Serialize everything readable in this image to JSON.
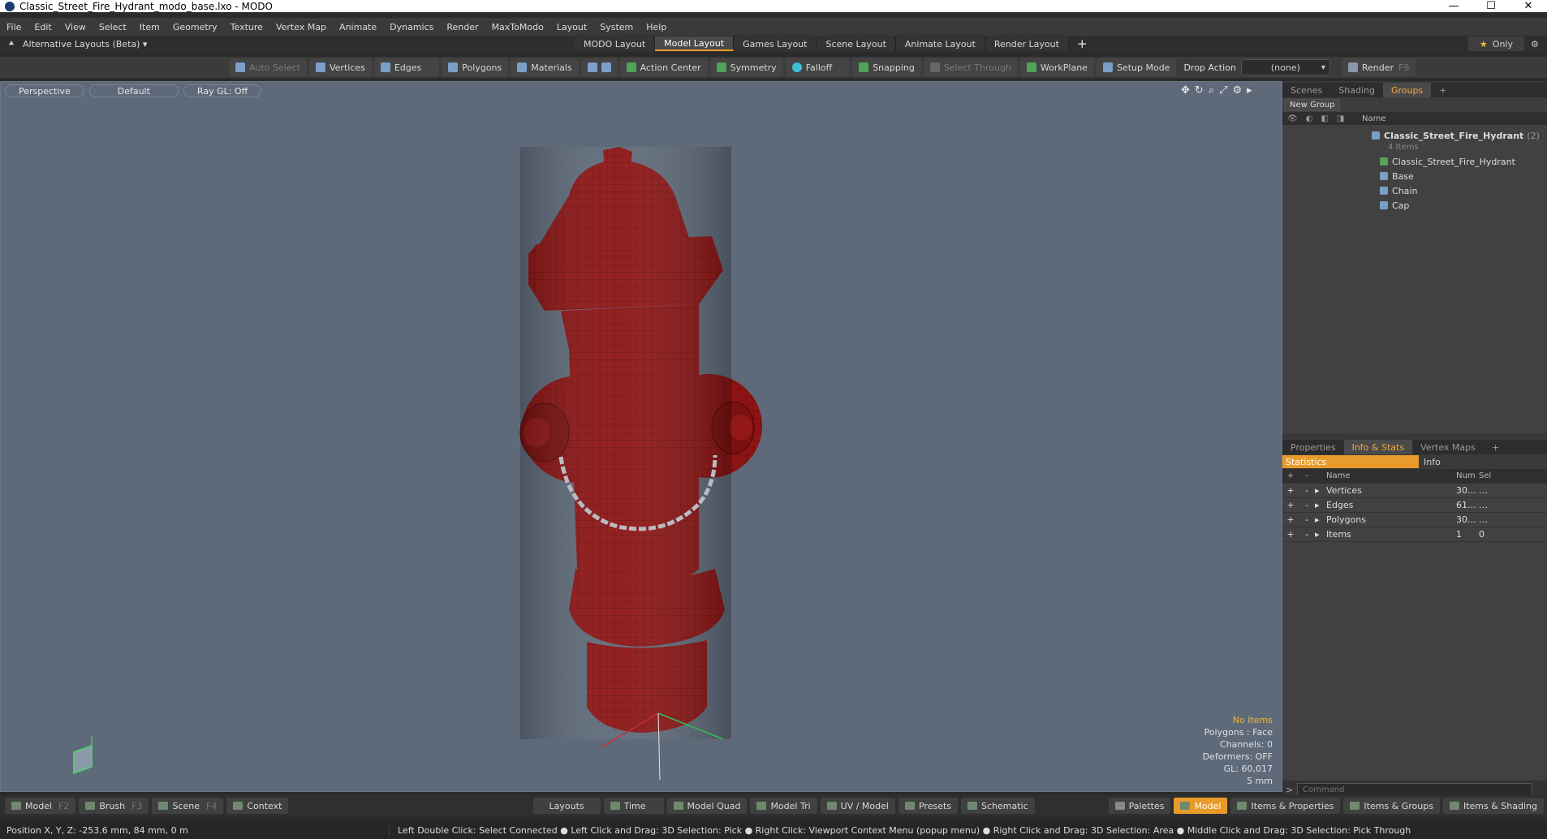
{
  "window": {
    "title": "Classic_Street_Fire_Hydrant_modo_base.lxo - MODO",
    "min": "—",
    "max": "☐",
    "close": "✕"
  },
  "menu": [
    "File",
    "Edit",
    "View",
    "Select",
    "Item",
    "Geometry",
    "Texture",
    "Vertex Map",
    "Animate",
    "Dynamics",
    "Render",
    "MaxToModo",
    "Layout",
    "System",
    "Help"
  ],
  "layoutbar": {
    "alt_layouts": "Alternative Layouts (Beta)",
    "tabs": [
      "MODO Layout",
      "Model Layout",
      "Games Layout",
      "Scene Layout",
      "Animate Layout",
      "Render Layout"
    ],
    "active_tab": "Model Layout",
    "add": "+",
    "only": "Only"
  },
  "toolbar": {
    "auto_select": "Auto Select",
    "vertices": "Vertices",
    "edges": "Edges",
    "polygons": "Polygons",
    "materials": "Materials",
    "action_center": "Action Center",
    "symmetry": "Symmetry",
    "falloff": "Falloff",
    "snapping": "Snapping",
    "select_through": "Select Through",
    "workplane": "WorkPlane",
    "setup_mode": "Setup Mode",
    "drop_action": "Drop Action",
    "drop_value": "(none)",
    "render": "Render",
    "render_key": "F9"
  },
  "viewport": {
    "perspective": "Perspective",
    "default": "Default",
    "raygl": "Ray GL: Off",
    "info": {
      "no_items": "No Items",
      "polygons": "Polygons : Face",
      "channels": "Channels: 0",
      "deformers": "Deformers: OFF",
      "gl": "GL: 60,017",
      "scale": "5 mm"
    },
    "model_color": "#8e1414"
  },
  "groups_panel": {
    "tabs": [
      "Scenes",
      "Shading",
      "Groups"
    ],
    "active_tab": "Groups",
    "new_group": "New Group",
    "name_header": "Name",
    "root": "Classic_Street_Fire_Hydrant",
    "root_count": "(2)",
    "root_sub": "4 Items",
    "children": [
      "Classic_Street_Fire_Hydrant",
      "Base",
      "Chain",
      "Cap"
    ]
  },
  "info_panel": {
    "tabs": [
      "Properties",
      "Info & Stats",
      "Vertex Maps"
    ],
    "active_tab": "Info & Stats",
    "statistics": "Statistics",
    "info": "Info",
    "headers": {
      "name": "Name",
      "num": "Num",
      "sel": "Sel"
    },
    "rows": [
      {
        "name": "Vertices",
        "num": "30…",
        "sel": "…"
      },
      {
        "name": "Edges",
        "num": "61…",
        "sel": "…"
      },
      {
        "name": "Polygons",
        "num": "30…",
        "sel": "…"
      },
      {
        "name": "Items",
        "num": "1",
        "sel": "0"
      }
    ],
    "command_placeholder": "Command"
  },
  "bottombar": {
    "model": "Model",
    "model_key": "F2",
    "brush": "Brush",
    "brush_key": "F3",
    "scene": "Scene",
    "scene_key": "F4",
    "context": "Context",
    "layouts": "Layouts",
    "time": "Time",
    "model_quad": "Model Quad",
    "model_tri": "Model Tri",
    "uv_model": "UV / Model",
    "presets": "Presets",
    "schematic": "Schematic",
    "palettes": "Palettes",
    "model_active": "Model",
    "items_properties": "Items & Properties",
    "items_groups": "Items & Groups",
    "items_shading": "Items & Shading"
  },
  "statusbar": {
    "position": "Position X, Y, Z:   -253.6 mm, 84 mm, 0 m",
    "hint": "Left Double Click: Select Connected ● Left Click and Drag: 3D Selection: Pick ● Right Click: Viewport Context Menu (popup menu) ● Right Click and Drag: 3D Selection: Area ● Middle Click and Drag: 3D Selection: Pick Through"
  }
}
